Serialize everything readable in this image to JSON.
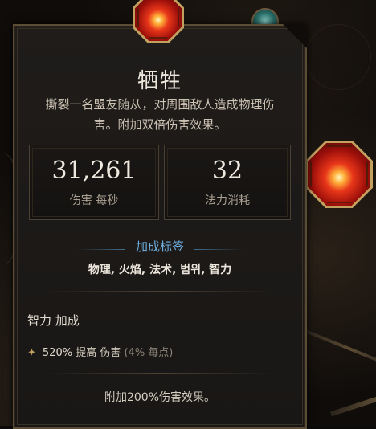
{
  "skill": {
    "name": "牺牲",
    "description": "撕裂一名盟友随从，对周围敌人造成物理伤害。附加双倍伤害效果。"
  },
  "stats": {
    "damage_value": "31,261",
    "damage_label": "伤害 每秒",
    "mana_value": "32",
    "mana_label": "法力消耗"
  },
  "tags": {
    "title": "加成标签",
    "list": "物理, 火焰, 法术, 범위, 智力"
  },
  "bonus": {
    "section_title": "智力 加成",
    "pct": "520%",
    "text": " 提高 伤害 ",
    "note": "(4% 每点)"
  },
  "footer": "附加200%伤害效果。",
  "colors": {
    "accent_tag": "#6fb0e0",
    "frame_gold": "#c2a060",
    "panel_bg": "#1c1917"
  },
  "icons": {
    "spell": "sacrifice-spell-icon",
    "bullet": "diamond-bullet-icon"
  }
}
